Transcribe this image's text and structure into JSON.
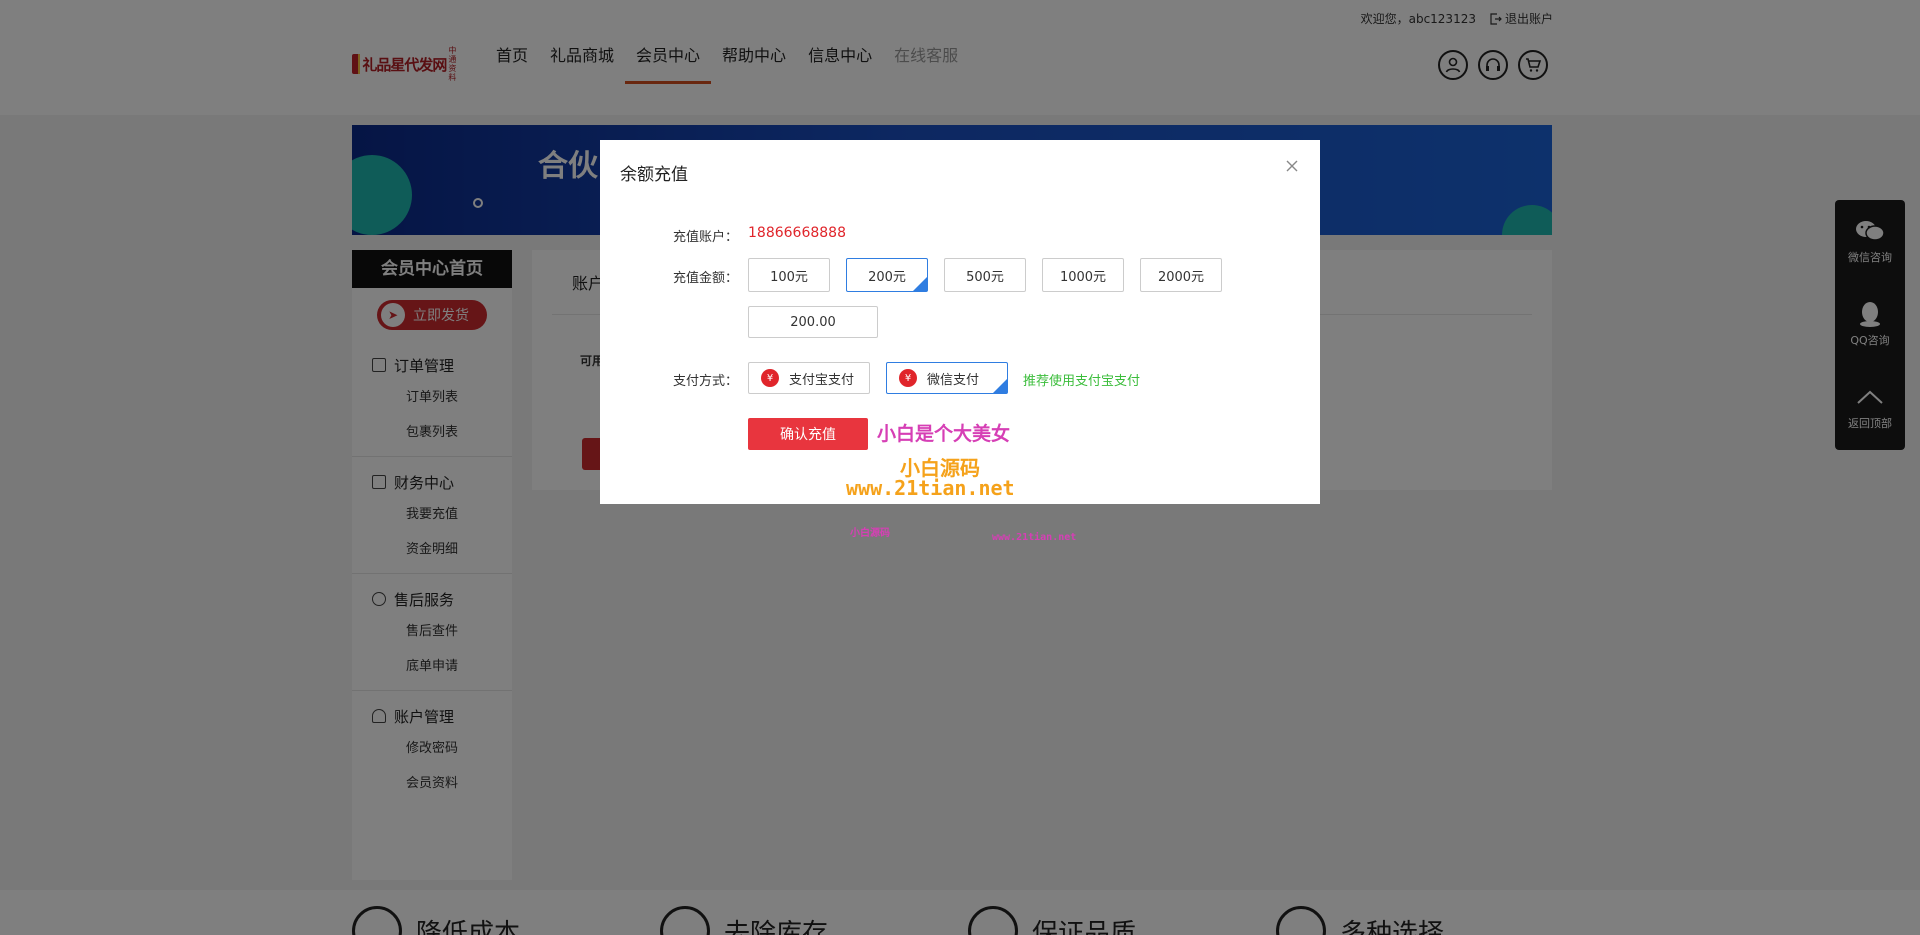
{
  "topbar": {
    "welcome": "欢迎您，abc123123",
    "logout": "退出账户"
  },
  "logo": {
    "text": "礼品星代发网",
    "mini": "中通资料"
  },
  "nav": [
    {
      "label": "首页"
    },
    {
      "label": "礼品商城"
    },
    {
      "label": "会员中心"
    },
    {
      "label": "帮助中心"
    },
    {
      "label": "信息中心"
    },
    {
      "label": "在线客服"
    }
  ],
  "banner": {
    "title": "合伙"
  },
  "sidebar": {
    "head": "会员中心首页",
    "ship_button": "立即发货",
    "groups": [
      {
        "title": "订单管理",
        "items": [
          "订单列表",
          "包裹列表"
        ]
      },
      {
        "title": "财务中心",
        "items": [
          "我要充值",
          "资金明细"
        ]
      },
      {
        "title": "售后服务",
        "items": [
          "售后查件",
          "底单申请"
        ]
      },
      {
        "title": "账户管理",
        "items": [
          "修改密码",
          "会员资料"
        ]
      }
    ]
  },
  "content": {
    "title": "账户",
    "label": "可用"
  },
  "floatbar": {
    "wechat": "微信咨询",
    "qq": "QQ咨询",
    "top": "返回顶部"
  },
  "footer": [
    {
      "label": "降低成本"
    },
    {
      "label": "去除库存"
    },
    {
      "label": "保证品质"
    },
    {
      "label": "多种选择"
    }
  ],
  "modal": {
    "title": "余额充值",
    "account_label": "充值账户：",
    "account_value": "18866668888",
    "amount_label": "充值金额：",
    "amounts": [
      "100元",
      "200元",
      "500元",
      "1000元",
      "2000元"
    ],
    "selected_amount_index": 1,
    "amount_value": "200.00",
    "pay_label": "支付方式：",
    "pay_methods": [
      "支付宝支付",
      "微信支付"
    ],
    "recommend": "推荐使用支付宝支付",
    "confirm": "确认充值",
    "bag_symbol": "¥"
  },
  "watermarks": {
    "w1": "小白是个大美女",
    "w2": "小白源码",
    "w3": "www.21tian.net",
    "w4": "小白源码",
    "w5": "www.21tian.net"
  },
  "colors": {
    "accent": "#e0252b",
    "select": "#2f7de1",
    "recommend": "#3bbd3b"
  }
}
